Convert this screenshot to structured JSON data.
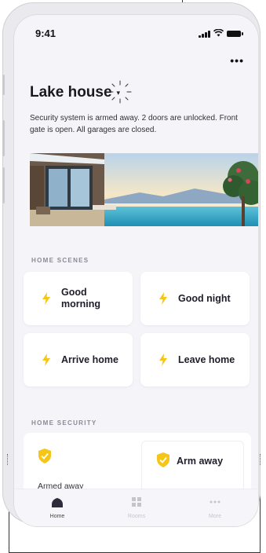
{
  "status_bar": {
    "time": "9:41"
  },
  "header": {
    "more_label": "•••",
    "title": "Lake house",
    "caret": "▾",
    "description": "Security system is armed away. 2 doors are unlocked. Front gate is open. All garages are closed."
  },
  "scenes": {
    "section_title": "HOME SCENES",
    "items": [
      {
        "label": "Good morning"
      },
      {
        "label": "Good night"
      },
      {
        "label": "Arrive home"
      },
      {
        "label": "Leave home"
      }
    ]
  },
  "security": {
    "section_title": "HOME SECURITY",
    "status_label": "Armed away",
    "arm_button_label": "Arm away"
  },
  "tabs": [
    {
      "label": "Home",
      "icon": "home-icon",
      "active": true
    },
    {
      "label": "Rooms",
      "icon": "rooms-icon",
      "active": false
    },
    {
      "label": "More",
      "icon": "more-icon",
      "active": false
    }
  ],
  "colors": {
    "accent": "#f5c518",
    "background": "#f4f4f9",
    "card": "#ffffff",
    "text": "#1e1e2a",
    "muted": "#8a8a98"
  }
}
